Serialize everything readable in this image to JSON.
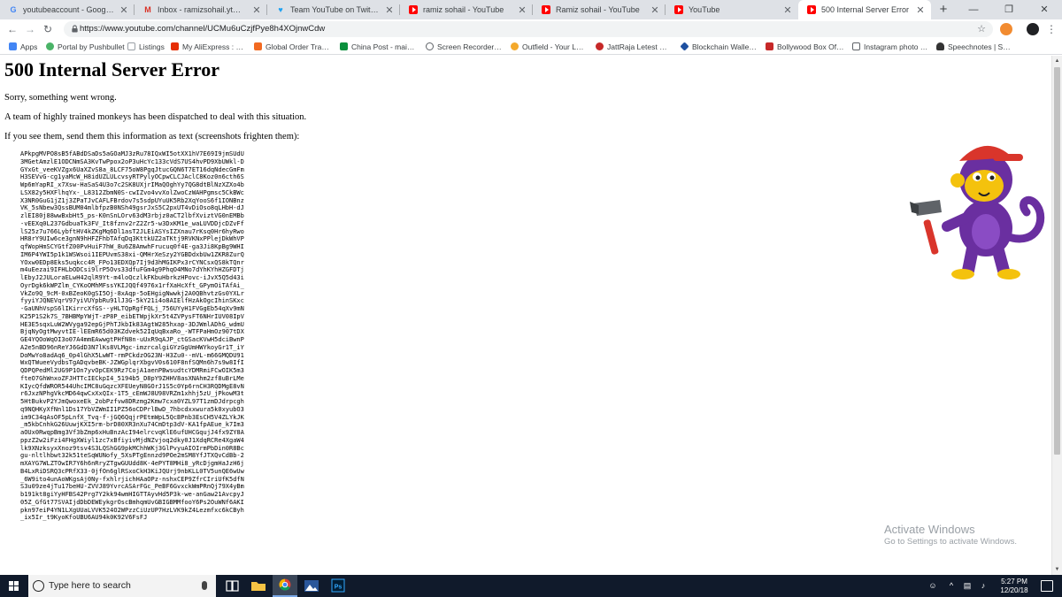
{
  "tabs": [
    {
      "title": "youtubeaccount - Google Search",
      "favicon": "google-icon"
    },
    {
      "title": "Inbox - ramizsohail.yt@gmail.com",
      "favicon": "gmail-icon"
    },
    {
      "title": "Team YouTube on Twitter: \"We'd",
      "favicon": "twitter-icon"
    },
    {
      "title": "ramiz sohail - YouTube",
      "favicon": "youtube-icon"
    },
    {
      "title": "Ramiz sohail - YouTube",
      "favicon": "youtube-icon"
    },
    {
      "title": "YouTube",
      "favicon": "youtube-icon"
    },
    {
      "title": "500 Internal Server Error",
      "favicon": "youtube-icon"
    }
  ],
  "address_bar": {
    "url": "https://www.youtube.com/channel/UCMu6uCzjfPye8h4XOjnwCdw"
  },
  "bookmarks": [
    {
      "label": "Apps",
      "icon": "apps-grid-icon",
      "color": "#4285f4"
    },
    {
      "label": "Portal by Pushbullet",
      "icon": "pushbullet-icon",
      "color": "#4ab367"
    },
    {
      "label": "Listings",
      "icon": "page-icon",
      "color": "#9aa0a6"
    },
    {
      "label": "My AliExpress : Mana",
      "icon": "aliexpress-icon",
      "color": "#e62e04"
    },
    {
      "label": "Global Order Tracking",
      "icon": "tracking-icon",
      "color": "#f26a21"
    },
    {
      "label": "China Post - mail trac",
      "icon": "china-post-icon",
      "color": "#0a8f3c"
    },
    {
      "label": "Screen Recorder - Re",
      "icon": "screen-recorder-icon",
      "color": "#5f6368"
    },
    {
      "label": "Outfield - Your Love",
      "icon": "outfield-icon",
      "color": "#f4a92c"
    },
    {
      "label": "JattRaja Letest Punja",
      "icon": "jattraja-icon",
      "color": "#c62828"
    },
    {
      "label": "Blockchain Wallet - E",
      "icon": "blockchain-icon",
      "color": "#1e50a0"
    },
    {
      "label": "Bollywood Box Office",
      "icon": "bollywood-icon",
      "color": "#c62828"
    },
    {
      "label": "Instagram photo dov",
      "icon": "instagram-icon",
      "color": "#5f6368"
    },
    {
      "label": "Speechnotes | Speec",
      "icon": "speechnotes-icon",
      "color": "#333333"
    }
  ],
  "error": {
    "title": "500 Internal Server Error",
    "line1": "Sorry, something went wrong.",
    "line2": "A team of highly trained monkeys has been dispatched to deal with this situation.",
    "line3": "If you see them, send them this information as text (screenshots frighten them):",
    "debug_text": "APkpgMVPO8sB5fABdDSaDs5aGOaMJ3zRu78IQxWI5otXX1hV7E69I9jmSUdU3MGetAmzlE1ODCNmSA3KvTwPpox2oP3uHcYc133cVdS7US4hvPD9XbUWkl-DGYxGt_veeKVZgx6UaXZvS8a_8LCF75oW8PgqJtucGQN6T7ET16dqNdecGmFmH3SEVvG-cg1yaMcW_H8idUZLULcvsyRTPylyOCpwCLCJAclC8Koz0n6cth6SWp6mYapRI_x7Xsw-HaSaS4U3o7c2SK8UXjrIMaQOghYy7QG8dtBlNzXZXo4bLSX82y5HXFlhqYx-_L8312ZbmN0S-cwIZvo4vvXolZwoCzWAHPgmsc5CkBWcX3NR0GuG1jZ1j3ZPaTJvCAFLFBrdov7s5sdpUYuUK5Rb2XqYooS6f1IONBnzVK_5sNbew3QssBUM04mlbfpzB0NSh49gsrJxS5C2pxUT4vDiOso8qLHbH-dJzlEI80j88wwBxbHt5_ps-K0nSnLOrv63dM3rbjz0aCT2lbfXviztVG0nEMBb-vEEXq0L237GdbuaTk3FV_It8fznv2rZ2Zr5-w3DxKM1e_waLUVDDjcDZvFflS25z7u766LybftHV4kZKgMq6Dl1asT2JLEiASYsIZXnau7rKsq0Hr6hyRwoHR8rY9UIw6ce3gnN9hHFZFhbTAfqDq3KttkUZ2aTKtj9RVKNxPPlejDkWhVPqfWopHmSCYGtfZ00PvHuiF7hW_8u6Z8AmwhFrucuq0f4E-ga3Ji8KpBg9WHIIM6P4YWI5p1k1WSWsoi1IEPUvmS38xi-QMHrXeSzy2YGBDdxbUw1ZKR8ZurQYOxw0EDp8Eks5uqkcc4R_FPo13EDXQp7Ij9d3hMGIKPx3rCYNCsxQS8kTQnrm4uEezai9IFHLbODCsi9lrP5Ovs33dfuFGm4g9PhqO4MNo7dYhKYhHZGFDTjlEbyJ2JULoraELwH42qlR9Yt-m4loQczlkFKbuHbrkzHPovc-iJvX5Q5d43iOyrDgk6kWPZlm_CYKoOMhMFssYKIJQQf4976x1rfXaHcXft_GPymOiTAfAi_VkZo9Q_9cM-0xBZeoK0gSI5Oj-8xAqp-5oEHgigNwwkj2A0QBhvtzGs0YXLrfyyiYJQNEVqrV97yiVUYpbRu91lJ3G-5kY21i4o8AIElfHzAkOgcIhinSKxc-GaUNhVspS6lIKirrcXfGS--yHLTQpRgfFQLj_756UYyH1FVGgEb54qXv9mNK25P1S2k7S_7BHBMpYWjT-zP8P_eibETWpjkXr5t4ZVPysFT6NHrIUV08IpVHE3E5sqxLuW2WVyga92epGjPhTJkbIk83AgtW285hxap-3DJWmlADhG_wdmUBjqNyOgtMwyvtIE-lEEmR65d03KZdvek52IqUqBxaRo_-WTFPaHmOz907tDXGE4YQOoWqOI3o07A4mmEAwwgtPHfN8n-uUxR9qAJP_ctGSacKVwH5dciBwnPA2e5nBD96nReYJ6GdD3N7lKs8VLMgc-imzrcalgiGYzGgUmHWYkoyGr1T_iYDoMwYo8adAq6_0p4lGhX5LwWT-rmPCkdzOG23N-H3Zu0--mVL-m66GMQDU91WxQTWueeVydbsTgADqvbeBK-JZWGplqrXbgvV0s610F8nfSQMn6h7s9w8IfIQDPQPedMl2UG9P1On7yvOpCEK9Rz7CojA1aenPBwsudtcYDMRmiFCwOIK5m3fteO7GhWnxoZFJHTTcIECkpI4_5194b5_D8pY9ZHHV8asXNAhm2zf8uBrLMeKIycQfdWROR544UhcIMC8uGqzcXFEUeyN8GOrJ1S5c0Yp6rnCH3RQDMgE8vNr6JxzNPhgVkcMD64qwCxXxQIx-1T5_cEmWJ8U98VRZm1xhhj5zU_jPkowM3t5HtBukvP2YJmQwoxeEk_2obPzfvw8DRzmg2Kmw7cxa0YZL97T1zmDJdrpcghq9NQHKyXfNnl1Ds17YbVZWmII1PZ56oCDPrlBwD_7hbcdxxwura5k0xyubO3im9C34qAsOF5pLnfX_Tvq-f-jGQ6QqjrPEtmWpL5QcBPnb3EsCH5V4ZLYkJK_m5kbCnhkG26UuwjKXI5rm-brD80XR3nXu74CmDtp3dV-KA1fpAEue_k7Im3aOUx0RwqpBmg3Vf3bZmp6xHuBnzAcI94elrcvqKlE6ufUHCGqujJ4fx9ZY8AppzZ2w2iFzi4FHgXWiyl1zc7xBfiyivMjdNZvjoq2dky0J1XdqRCRe4XgaW4lk9XNzksyxXnoz9tsv4S3LQShGG9pkMChhWKj3GlPvyuAIOIrmPbDin0R8Bcgu-nltlhbwt32k51teSqWUNofy_5XsPTgEnnzd9POe2mSM8YfJTXQvCdBb-2mXAYG7WLZTOwIR7Y6h6nRryZTgwGUUdd8K-4ePYT8MHi8_yRcDjgmHaJzH6jB4LxRiDSRQ3cPRfX33-0jfOn6glRSxoCkH3KiJQUrj9nbKLL0TV5unQE6wUw_6W9ito4unAoWKgsAj0Ny-fxhlrjichHAaOPz-nshxCEP9ZfrCIriUfK5dfNS3u09ze4jTu17beHU-ZVVJ89YvrcASArFGc_PeBF6GvxckWmPRnQj79X4yBmb191kt8giYyHFBS42Prg7Y2kk94wmHIGTTAyvHd5P3k-we-anGaw21AvcpyJ05Z_GfGt77SVAIjdDbDEWEykgrOscBmhqmUvGBIGBMMfooY6Ps2OuWNf6AKIpkn97eiP4YN1LXgUUaLVVK524O2WPzzCiUzUP7HzLVK9kZ4Lezmfxc6kCByh_ix5Ir_t9KyoKfoUBU6AU94k0K92V6FsFJ"
  },
  "watermark": {
    "line1": "Activate Windows",
    "line2": "Go to Settings to activate Windows."
  },
  "taskbar": {
    "search_placeholder": "Type here to search",
    "time": "5:27 PM",
    "date": "12/20/18",
    "apps": [
      "task-view-icon",
      "file-explorer-icon",
      "chrome-icon",
      "photos-icon",
      "photoshop-icon"
    ]
  },
  "scrollbar": {
    "thumb_fraction": 0.78
  }
}
